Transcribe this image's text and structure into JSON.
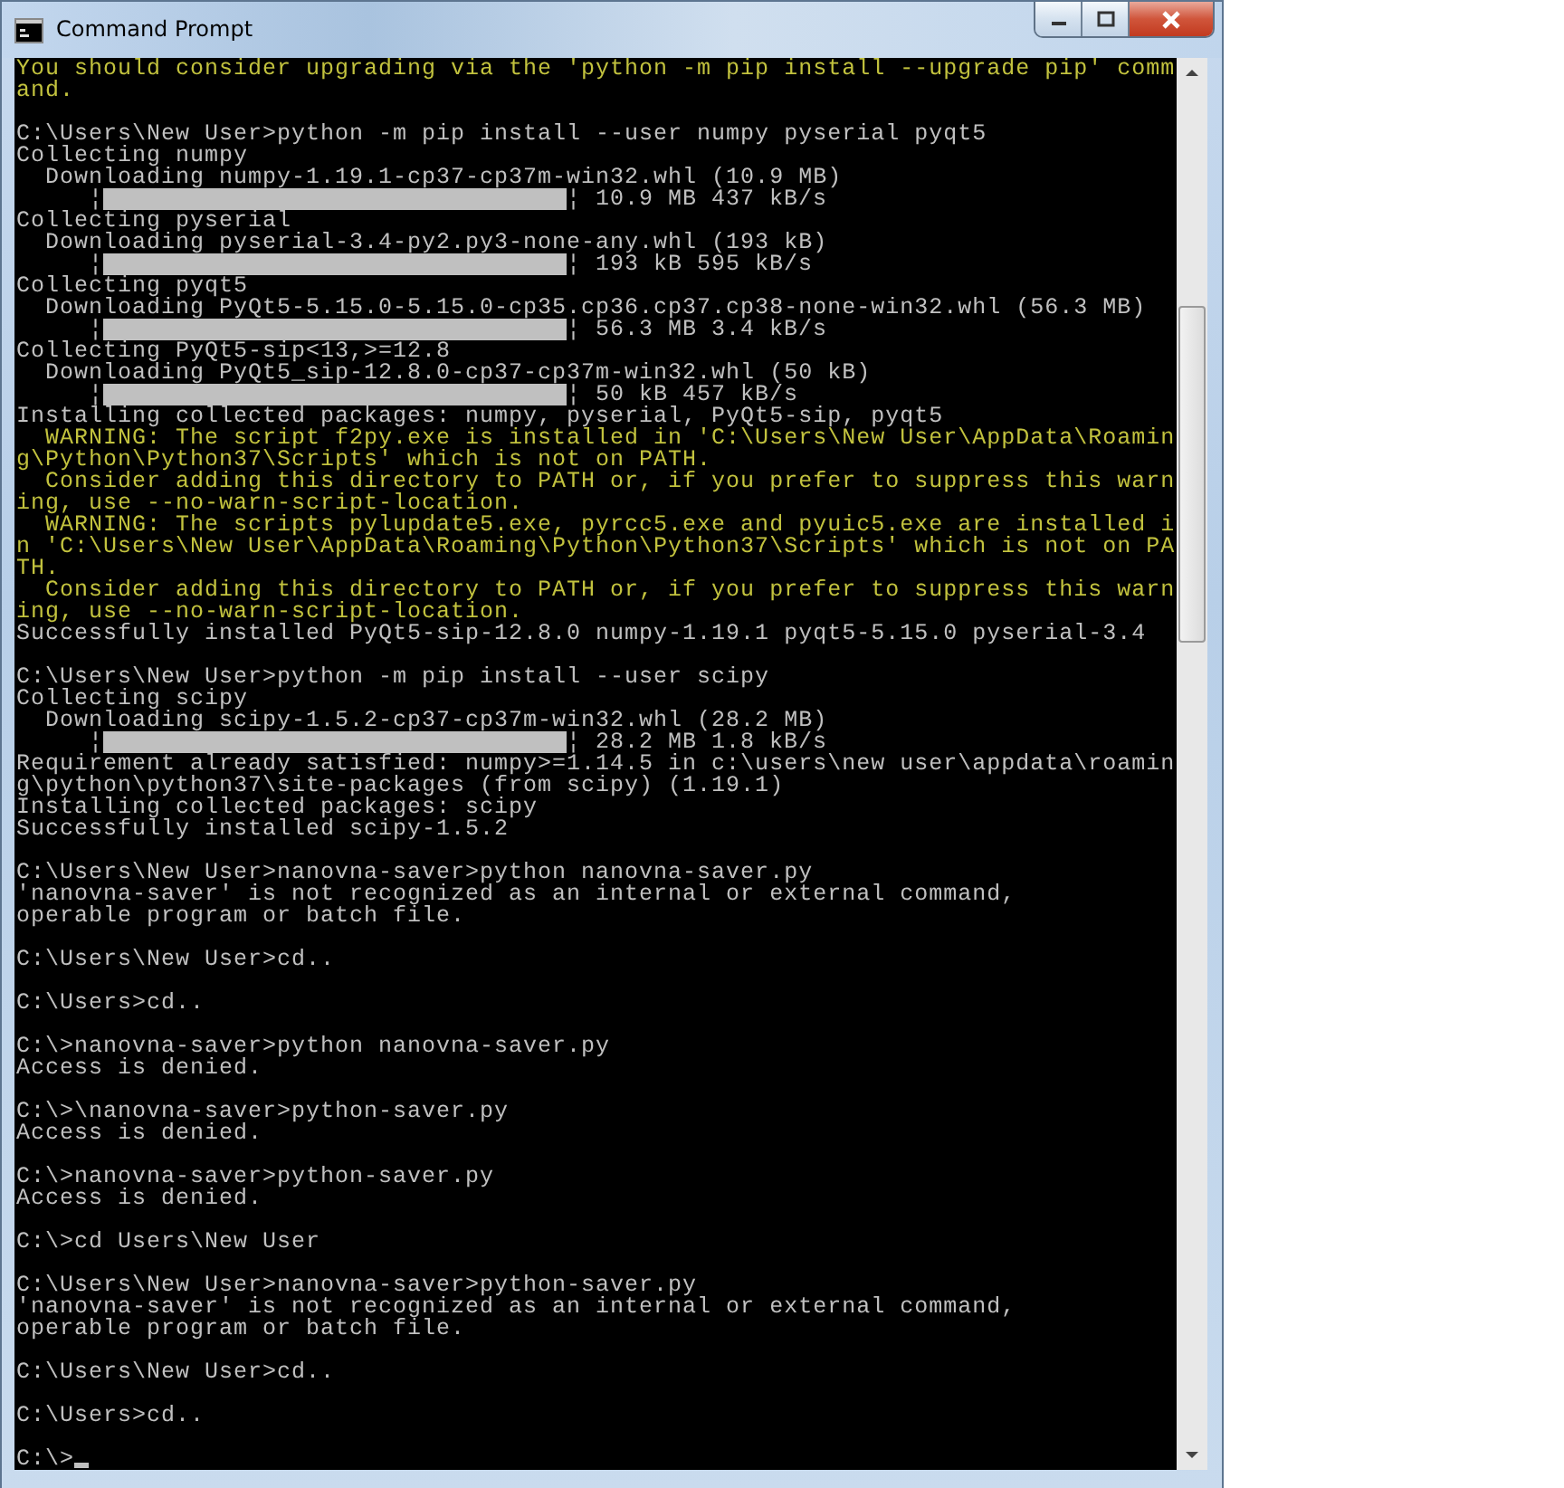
{
  "window": {
    "title": "Command Prompt"
  },
  "console": {
    "lines": [
      {
        "kind": "warning",
        "text": "You should consider upgrading via the 'python -m pip install --upgrade pip' comm"
      },
      {
        "kind": "warning",
        "text": "and."
      },
      {
        "kind": "blank"
      },
      {
        "kind": "output",
        "text": "C:\\Users\\New User>python -m pip install --user numpy pyserial pyqt5"
      },
      {
        "kind": "output",
        "text": "Collecting numpy"
      },
      {
        "kind": "output",
        "text": "  Downloading numpy-1.19.1-cp37-cp37m-win32.whl (10.9 MB)"
      },
      {
        "kind": "progress",
        "left": "     ¦",
        "level": 1,
        "right": "¦ 10.9 MB 437 kB/s"
      },
      {
        "kind": "output",
        "text": "Collecting pyserial"
      },
      {
        "kind": "output",
        "text": "  Downloading pyserial-3.4-py2.py3-none-any.whl (193 kB)"
      },
      {
        "kind": "progress",
        "left": "     ¦",
        "level": 1,
        "right": "¦ 193 kB 595 kB/s"
      },
      {
        "kind": "output",
        "text": "Collecting pyqt5"
      },
      {
        "kind": "output",
        "text": "  Downloading PyQt5-5.15.0-5.15.0-cp35.cp36.cp37.cp38-none-win32.whl (56.3 MB)"
      },
      {
        "kind": "progress",
        "left": "     ¦",
        "level": 1,
        "right": "¦ 56.3 MB 3.4 kB/s"
      },
      {
        "kind": "output",
        "text": "Collecting PyQt5-sip<13,>=12.8"
      },
      {
        "kind": "output",
        "text": "  Downloading PyQt5_sip-12.8.0-cp37-cp37m-win32.whl (50 kB)"
      },
      {
        "kind": "progress",
        "left": "     ¦",
        "level": 1,
        "right": "¦ 50 kB 457 kB/s"
      },
      {
        "kind": "output",
        "text": "Installing collected packages: numpy, pyserial, PyQt5-sip, pyqt5"
      },
      {
        "kind": "warning",
        "text": "  WARNING: The script f2py.exe is installed in 'C:\\Users\\New User\\AppData\\Roamin"
      },
      {
        "kind": "warning",
        "text": "g\\Python\\Python37\\Scripts' which is not on PATH."
      },
      {
        "kind": "warning",
        "text": "  Consider adding this directory to PATH or, if you prefer to suppress this warn"
      },
      {
        "kind": "warning",
        "text": "ing, use --no-warn-script-location."
      },
      {
        "kind": "warning",
        "text": "  WARNING: The scripts pylupdate5.exe, pyrcc5.exe and pyuic5.exe are installed i"
      },
      {
        "kind": "warning",
        "text": "n 'C:\\Users\\New User\\AppData\\Roaming\\Python\\Python37\\Scripts' which is not on PA"
      },
      {
        "kind": "warning",
        "text": "TH."
      },
      {
        "kind": "warning",
        "text": "  Consider adding this directory to PATH or, if you prefer to suppress this warn"
      },
      {
        "kind": "warning",
        "text": "ing, use --no-warn-script-location."
      },
      {
        "kind": "output",
        "text": "Successfully installed PyQt5-sip-12.8.0 numpy-1.19.1 pyqt5-5.15.0 pyserial-3.4"
      },
      {
        "kind": "blank"
      },
      {
        "kind": "output",
        "text": "C:\\Users\\New User>python -m pip install --user scipy"
      },
      {
        "kind": "output",
        "text": "Collecting scipy"
      },
      {
        "kind": "output",
        "text": "  Downloading scipy-1.5.2-cp37-cp37m-win32.whl (28.2 MB)"
      },
      {
        "kind": "progress",
        "left": "     ¦",
        "level": 1,
        "right": "¦ 28.2 MB 1.8 kB/s"
      },
      {
        "kind": "output",
        "text": "Requirement already satisfied: numpy>=1.14.5 in c:\\users\\new user\\appdata\\roamin"
      },
      {
        "kind": "output",
        "text": "g\\python\\python37\\site-packages (from scipy) (1.19.1)"
      },
      {
        "kind": "output",
        "text": "Installing collected packages: scipy"
      },
      {
        "kind": "output",
        "text": "Successfully installed scipy-1.5.2"
      },
      {
        "kind": "blank"
      },
      {
        "kind": "output",
        "text": "C:\\Users\\New User>nanovna-saver>python nanovna-saver.py"
      },
      {
        "kind": "output",
        "text": "'nanovna-saver' is not recognized as an internal or external command,"
      },
      {
        "kind": "output",
        "text": "operable program or batch file."
      },
      {
        "kind": "blank"
      },
      {
        "kind": "output",
        "text": "C:\\Users\\New User>cd.."
      },
      {
        "kind": "blank"
      },
      {
        "kind": "output",
        "text": "C:\\Users>cd.."
      },
      {
        "kind": "blank"
      },
      {
        "kind": "output",
        "text": "C:\\>nanovna-saver>python nanovna-saver.py"
      },
      {
        "kind": "output",
        "text": "Access is denied."
      },
      {
        "kind": "blank"
      },
      {
        "kind": "output",
        "text": "C:\\>\\nanovna-saver>python-saver.py"
      },
      {
        "kind": "output",
        "text": "Access is denied."
      },
      {
        "kind": "blank"
      },
      {
        "kind": "output",
        "text": "C:\\>nanovna-saver>python-saver.py"
      },
      {
        "kind": "output",
        "text": "Access is denied."
      },
      {
        "kind": "blank"
      },
      {
        "kind": "output",
        "text": "C:\\>cd Users\\New User"
      },
      {
        "kind": "blank"
      },
      {
        "kind": "output",
        "text": "C:\\Users\\New User>nanovna-saver>python-saver.py"
      },
      {
        "kind": "output",
        "text": "'nanovna-saver' is not recognized as an internal or external command,"
      },
      {
        "kind": "output",
        "text": "operable program or batch file."
      },
      {
        "kind": "blank"
      },
      {
        "kind": "output",
        "text": "C:\\Users\\New User>cd.."
      },
      {
        "kind": "blank"
      },
      {
        "kind": "output",
        "text": "C:\\Users>cd.."
      },
      {
        "kind": "blank"
      },
      {
        "kind": "prompt",
        "text": "C:\\>"
      }
    ]
  }
}
